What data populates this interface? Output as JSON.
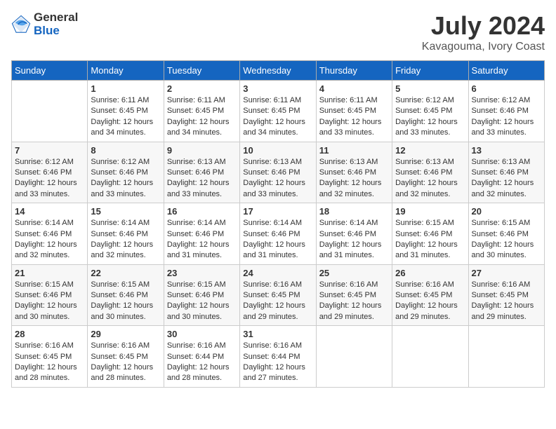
{
  "header": {
    "logo_general": "General",
    "logo_blue": "Blue",
    "month": "July 2024",
    "location": "Kavagouma, Ivory Coast"
  },
  "calendar": {
    "days_of_week": [
      "Sunday",
      "Monday",
      "Tuesday",
      "Wednesday",
      "Thursday",
      "Friday",
      "Saturday"
    ],
    "weeks": [
      [
        {
          "day": "",
          "info": ""
        },
        {
          "day": "1",
          "info": "Sunrise: 6:11 AM\nSunset: 6:45 PM\nDaylight: 12 hours\nand 34 minutes."
        },
        {
          "day": "2",
          "info": "Sunrise: 6:11 AM\nSunset: 6:45 PM\nDaylight: 12 hours\nand 34 minutes."
        },
        {
          "day": "3",
          "info": "Sunrise: 6:11 AM\nSunset: 6:45 PM\nDaylight: 12 hours\nand 34 minutes."
        },
        {
          "day": "4",
          "info": "Sunrise: 6:11 AM\nSunset: 6:45 PM\nDaylight: 12 hours\nand 33 minutes."
        },
        {
          "day": "5",
          "info": "Sunrise: 6:12 AM\nSunset: 6:45 PM\nDaylight: 12 hours\nand 33 minutes."
        },
        {
          "day": "6",
          "info": "Sunrise: 6:12 AM\nSunset: 6:46 PM\nDaylight: 12 hours\nand 33 minutes."
        }
      ],
      [
        {
          "day": "7",
          "info": ""
        },
        {
          "day": "8",
          "info": "Sunrise: 6:12 AM\nSunset: 6:46 PM\nDaylight: 12 hours\nand 33 minutes."
        },
        {
          "day": "9",
          "info": "Sunrise: 6:13 AM\nSunset: 6:46 PM\nDaylight: 12 hours\nand 33 minutes."
        },
        {
          "day": "10",
          "info": "Sunrise: 6:13 AM\nSunset: 6:46 PM\nDaylight: 12 hours\nand 33 minutes."
        },
        {
          "day": "11",
          "info": "Sunrise: 6:13 AM\nSunset: 6:46 PM\nDaylight: 12 hours\nand 32 minutes."
        },
        {
          "day": "12",
          "info": "Sunrise: 6:13 AM\nSunset: 6:46 PM\nDaylight: 12 hours\nand 32 minutes."
        },
        {
          "day": "13",
          "info": "Sunrise: 6:13 AM\nSunset: 6:46 PM\nDaylight: 12 hours\nand 32 minutes."
        }
      ],
      [
        {
          "day": "14",
          "info": ""
        },
        {
          "day": "15",
          "info": "Sunrise: 6:14 AM\nSunset: 6:46 PM\nDaylight: 12 hours\nand 32 minutes."
        },
        {
          "day": "16",
          "info": "Sunrise: 6:14 AM\nSunset: 6:46 PM\nDaylight: 12 hours\nand 31 minutes."
        },
        {
          "day": "17",
          "info": "Sunrise: 6:14 AM\nSunset: 6:46 PM\nDaylight: 12 hours\nand 31 minutes."
        },
        {
          "day": "18",
          "info": "Sunrise: 6:14 AM\nSunset: 6:46 PM\nDaylight: 12 hours\nand 31 minutes."
        },
        {
          "day": "19",
          "info": "Sunrise: 6:15 AM\nSunset: 6:46 PM\nDaylight: 12 hours\nand 31 minutes."
        },
        {
          "day": "20",
          "info": "Sunrise: 6:15 AM\nSunset: 6:46 PM\nDaylight: 12 hours\nand 30 minutes."
        }
      ],
      [
        {
          "day": "21",
          "info": ""
        },
        {
          "day": "22",
          "info": "Sunrise: 6:15 AM\nSunset: 6:46 PM\nDaylight: 12 hours\nand 30 minutes."
        },
        {
          "day": "23",
          "info": "Sunrise: 6:15 AM\nSunset: 6:46 PM\nDaylight: 12 hours\nand 30 minutes."
        },
        {
          "day": "24",
          "info": "Sunrise: 6:16 AM\nSunset: 6:45 PM\nDaylight: 12 hours\nand 29 minutes."
        },
        {
          "day": "25",
          "info": "Sunrise: 6:16 AM\nSunset: 6:45 PM\nDaylight: 12 hours\nand 29 minutes."
        },
        {
          "day": "26",
          "info": "Sunrise: 6:16 AM\nSunset: 6:45 PM\nDaylight: 12 hours\nand 29 minutes."
        },
        {
          "day": "27",
          "info": "Sunrise: 6:16 AM\nSunset: 6:45 PM\nDaylight: 12 hours\nand 29 minutes."
        }
      ],
      [
        {
          "day": "28",
          "info": "Sunrise: 6:16 AM\nSunset: 6:45 PM\nDaylight: 12 hours\nand 28 minutes."
        },
        {
          "day": "29",
          "info": "Sunrise: 6:16 AM\nSunset: 6:45 PM\nDaylight: 12 hours\nand 28 minutes."
        },
        {
          "day": "30",
          "info": "Sunrise: 6:16 AM\nSunset: 6:44 PM\nDaylight: 12 hours\nand 28 minutes."
        },
        {
          "day": "31",
          "info": "Sunrise: 6:16 AM\nSunset: 6:44 PM\nDaylight: 12 hours\nand 27 minutes."
        },
        {
          "day": "",
          "info": ""
        },
        {
          "day": "",
          "info": ""
        },
        {
          "day": "",
          "info": ""
        }
      ]
    ],
    "week1_sunday_info": "Sunrise: 6:12 AM\nSunset: 6:46 PM\nDaylight: 12 hours\nand 33 minutes.",
    "week2_sunday_info": "Sunrise: 6:12 AM\nSunset: 6:46 PM\nDaylight: 12 hours\nand 33 minutes.",
    "week3_sunday_info": "Sunrise: 6:14 AM\nSunset: 6:46 PM\nDaylight: 12 hours\nand 32 minutes.",
    "week4_sunday_info": "Sunrise: 6:15 AM\nSunset: 6:46 PM\nDaylight: 12 hours\nand 30 minutes."
  }
}
